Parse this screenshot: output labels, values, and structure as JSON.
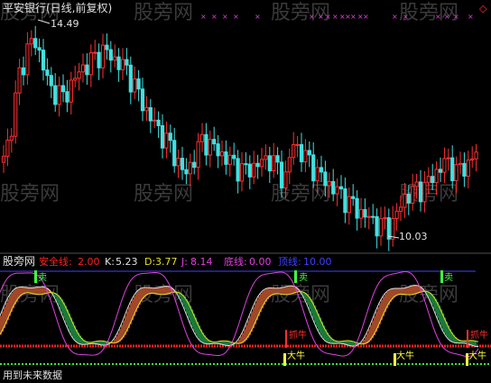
{
  "main_chart": {
    "title": "平安银行(日线,前复权)",
    "high_marker": "14.49",
    "low_marker": "10.03",
    "top_right_marker": "◇",
    "watermark": "股旁网"
  },
  "indicator_bar": {
    "name": "股旁网",
    "items": [
      {
        "label": "安全线:",
        "value": "2.00",
        "color": "#ff2020"
      },
      {
        "label": "K:",
        "value": "5.23",
        "color": "#e0e0e0"
      },
      {
        "label": "D:",
        "value": "3.77",
        "color": "#e0e020"
      },
      {
        "label": "J:",
        "value": "8.14",
        "color": "#e040e0"
      },
      {
        "label": "底线:",
        "value": "0.00",
        "color": "#e040e0"
      },
      {
        "label": "顶线:",
        "value": "10.00",
        "color": "#4040ff"
      }
    ]
  },
  "signals": {
    "sell_label": "卖",
    "big_bull_label": "大牛",
    "catch_bull_label": "抓牛"
  },
  "footer": {
    "text": "用到未来数据"
  },
  "colors": {
    "up": "#ff3030",
    "down": "#40e0e0",
    "cross_mark": "#e040e0",
    "kline": "#e0e0e0",
    "dline": "#e0e020",
    "jline": "#e040e0",
    "topline": "#4040ff",
    "safeline": "#ff2020",
    "bottomline": "#40e040"
  }
}
